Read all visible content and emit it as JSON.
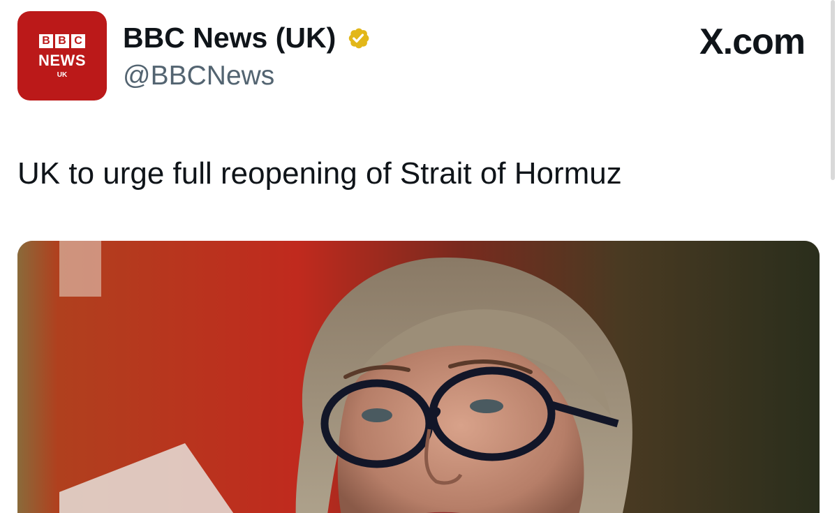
{
  "account": {
    "avatar": {
      "blocks": [
        "B",
        "B",
        "C"
      ],
      "news_text": "NEWS",
      "region_text": "UK",
      "background_color": "#bb1919"
    },
    "display_name": "BBC News (UK)",
    "verified_badge": "gold-verified-icon",
    "handle": "@BBCNews"
  },
  "platform_label": "X.com",
  "tweet": {
    "text": "UK to urge full reopening of Strait of Hormuz"
  },
  "media": {
    "kind": "photo"
  },
  "colors": {
    "text_primary": "#0f1419",
    "text_secondary": "#536471",
    "verified_gold": "#e2b719",
    "bbc_red": "#bb1919"
  }
}
